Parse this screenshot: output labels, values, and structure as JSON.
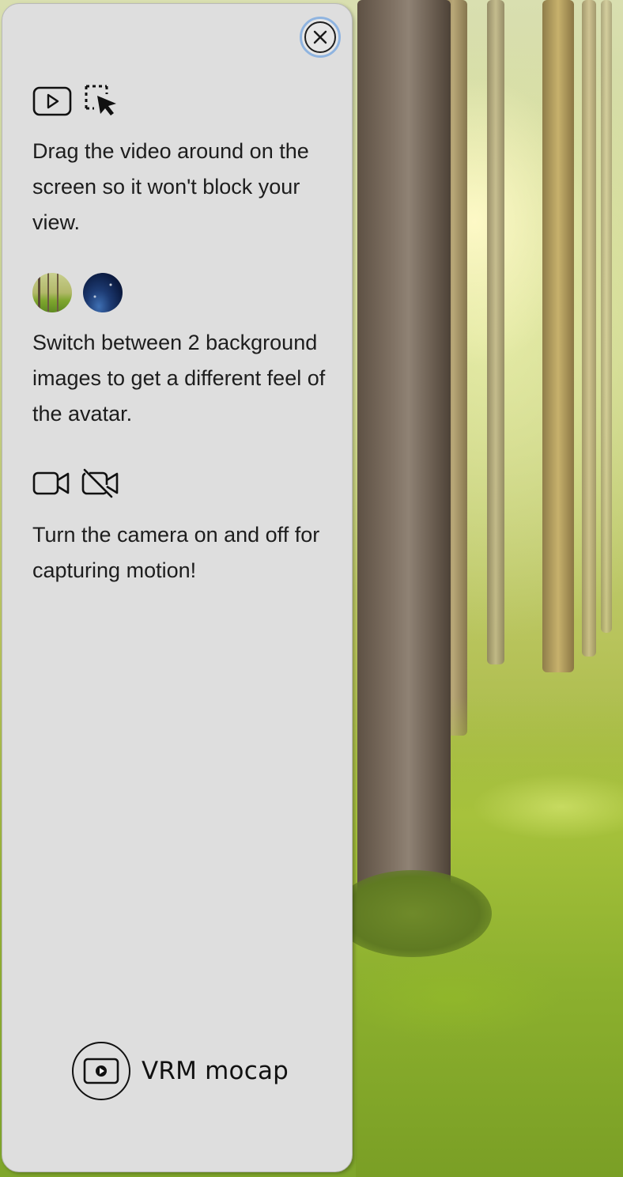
{
  "panel": {
    "close_label": "×",
    "sections": [
      {
        "icons": [
          "video-play-icon",
          "drag-select-cursor-icon"
        ],
        "text": "Drag the video around on the screen so it won't block your view."
      },
      {
        "icons": [
          "forest-background-thumbnail",
          "space-background-thumbnail"
        ],
        "text": "Switch between 2 background images to get a different feel of the avatar."
      },
      {
        "icons": [
          "camera-on-icon",
          "camera-off-icon"
        ],
        "text": "Turn the camera on and off for capturing motion!"
      }
    ]
  },
  "brand": {
    "name": "VRM mocap",
    "icon": "video-play-icon"
  },
  "colors": {
    "panel_bg": "#dedede",
    "focus_ring": "#8fb4e0",
    "text": "#1d1d1d"
  }
}
